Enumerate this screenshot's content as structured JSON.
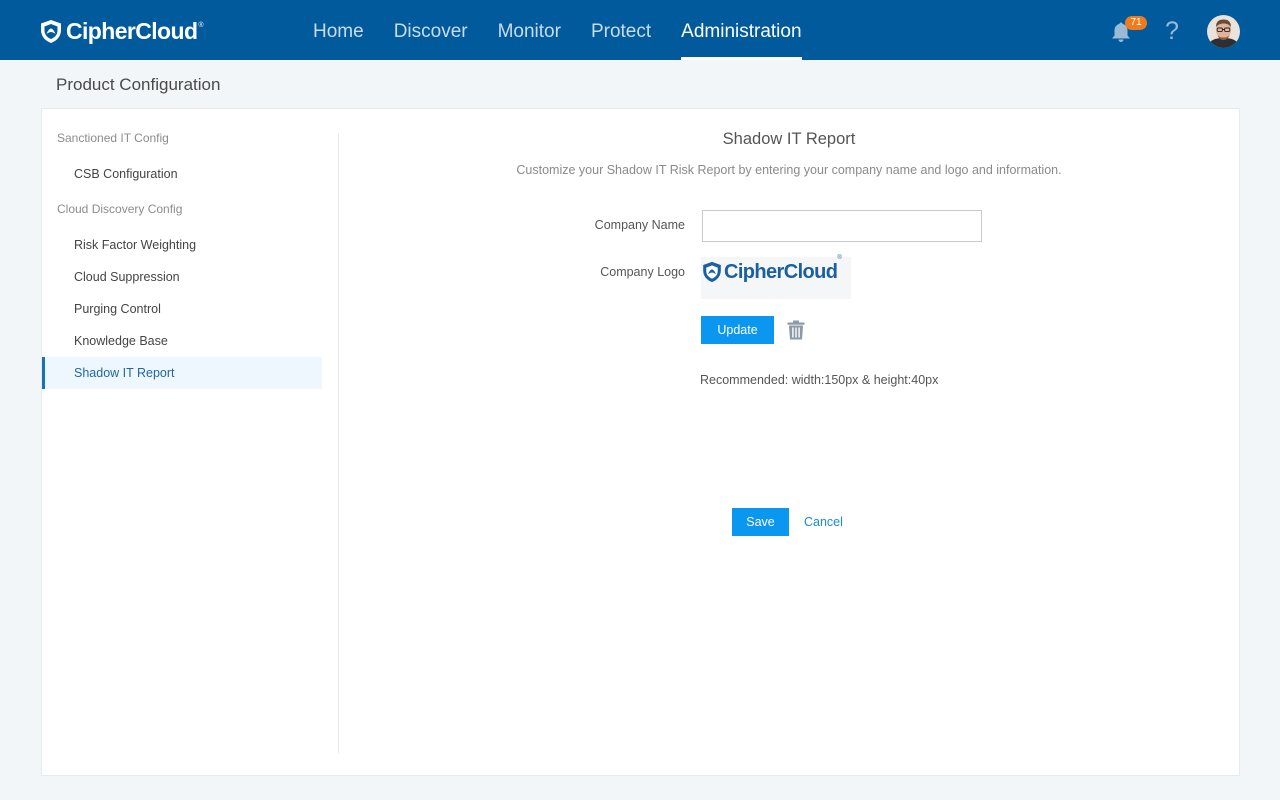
{
  "brand": {
    "name": "CipherCloud",
    "reg": "®"
  },
  "nav": [
    {
      "label": "Home"
    },
    {
      "label": "Discover"
    },
    {
      "label": "Monitor"
    },
    {
      "label": "Protect"
    },
    {
      "label": "Administration",
      "active": true
    }
  ],
  "header": {
    "notification_count": "71",
    "help_label": "?"
  },
  "page": {
    "title": "Product Configuration"
  },
  "sidebar": {
    "groups": [
      {
        "label": "Sanctioned IT Config",
        "items": [
          {
            "label": "CSB Configuration"
          }
        ]
      },
      {
        "label": "Cloud Discovery Config",
        "items": [
          {
            "label": "Risk Factor Weighting"
          },
          {
            "label": "Cloud Suppression"
          },
          {
            "label": "Purging Control"
          },
          {
            "label": "Knowledge Base"
          },
          {
            "label": "Shadow IT Report",
            "active": true
          }
        ]
      }
    ]
  },
  "form": {
    "title": "Shadow IT Report",
    "description": "Customize your Shadow IT Risk Report by entering your company name and logo and information.",
    "company_name_label": "Company Name",
    "company_name_value": "",
    "company_logo_label": "Company Logo",
    "logo_name": "CipherCloud",
    "logo_reg": "®",
    "update_label": "Update",
    "recommendation": "Recommended: width:150px & height:40px",
    "save_label": "Save",
    "cancel_label": "Cancel"
  },
  "colors": {
    "topbar": "#005a9c",
    "accent_button": "#0b97f0",
    "active_menu_bg": "#eef7fd",
    "badge": "#f07b1e"
  },
  "icons": {
    "brand": "shield-logo-icon",
    "notifications": "bell-icon",
    "help": "question-mark-icon",
    "delete": "trash-icon"
  }
}
